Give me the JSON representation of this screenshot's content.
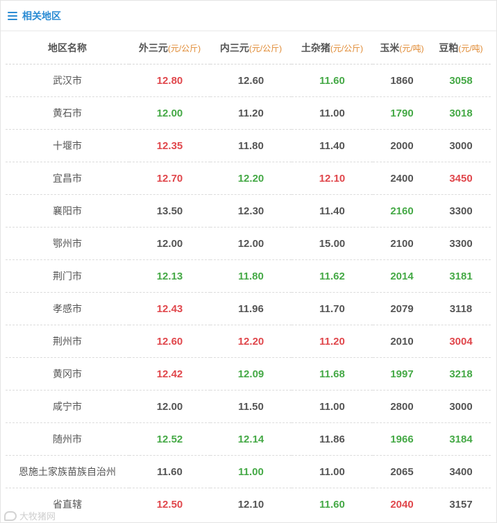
{
  "panel": {
    "title": "相关地区",
    "icon": "menu-icon"
  },
  "table": {
    "columns": [
      {
        "label": "地区名称",
        "unit": ""
      },
      {
        "label": "外三元",
        "unit": "(元/公斤)"
      },
      {
        "label": "内三元",
        "unit": "(元/公斤)"
      },
      {
        "label": "土杂猪",
        "unit": "(元/公斤)"
      },
      {
        "label": "玉米",
        "unit": "(元/吨)"
      },
      {
        "label": "豆粕",
        "unit": "(元/吨)"
      }
    ],
    "colors": {
      "up": "#e0474c",
      "down": "#45a946",
      "flat": "#555555"
    },
    "rows": [
      {
        "name": "武汉市",
        "cells": [
          {
            "v": "12.80",
            "c": "red"
          },
          {
            "v": "12.60",
            "c": ""
          },
          {
            "v": "11.60",
            "c": "green"
          },
          {
            "v": "1860",
            "c": ""
          },
          {
            "v": "3058",
            "c": "green"
          }
        ]
      },
      {
        "name": "黄石市",
        "cells": [
          {
            "v": "12.00",
            "c": "green"
          },
          {
            "v": "11.20",
            "c": ""
          },
          {
            "v": "11.00",
            "c": ""
          },
          {
            "v": "1790",
            "c": "green"
          },
          {
            "v": "3018",
            "c": "green"
          }
        ]
      },
      {
        "name": "十堰市",
        "cells": [
          {
            "v": "12.35",
            "c": "red"
          },
          {
            "v": "11.80",
            "c": ""
          },
          {
            "v": "11.40",
            "c": ""
          },
          {
            "v": "2000",
            "c": ""
          },
          {
            "v": "3000",
            "c": ""
          }
        ]
      },
      {
        "name": "宜昌市",
        "cells": [
          {
            "v": "12.70",
            "c": "red"
          },
          {
            "v": "12.20",
            "c": "green"
          },
          {
            "v": "12.10",
            "c": "red"
          },
          {
            "v": "2400",
            "c": ""
          },
          {
            "v": "3450",
            "c": "red"
          }
        ]
      },
      {
        "name": "襄阳市",
        "cells": [
          {
            "v": "13.50",
            "c": ""
          },
          {
            "v": "12.30",
            "c": ""
          },
          {
            "v": "11.40",
            "c": ""
          },
          {
            "v": "2160",
            "c": "green"
          },
          {
            "v": "3300",
            "c": ""
          }
        ]
      },
      {
        "name": "鄂州市",
        "cells": [
          {
            "v": "12.00",
            "c": ""
          },
          {
            "v": "12.00",
            "c": ""
          },
          {
            "v": "15.00",
            "c": ""
          },
          {
            "v": "2100",
            "c": ""
          },
          {
            "v": "3300",
            "c": ""
          }
        ]
      },
      {
        "name": "荆门市",
        "cells": [
          {
            "v": "12.13",
            "c": "green"
          },
          {
            "v": "11.80",
            "c": "green"
          },
          {
            "v": "11.62",
            "c": "green"
          },
          {
            "v": "2014",
            "c": "green"
          },
          {
            "v": "3181",
            "c": "green"
          }
        ]
      },
      {
        "name": "孝感市",
        "cells": [
          {
            "v": "12.43",
            "c": "red"
          },
          {
            "v": "11.96",
            "c": ""
          },
          {
            "v": "11.70",
            "c": ""
          },
          {
            "v": "2079",
            "c": ""
          },
          {
            "v": "3118",
            "c": ""
          }
        ]
      },
      {
        "name": "荆州市",
        "cells": [
          {
            "v": "12.60",
            "c": "red"
          },
          {
            "v": "12.20",
            "c": "red"
          },
          {
            "v": "11.20",
            "c": "red"
          },
          {
            "v": "2010",
            "c": ""
          },
          {
            "v": "3004",
            "c": "red"
          }
        ]
      },
      {
        "name": "黄冈市",
        "cells": [
          {
            "v": "12.42",
            "c": "red"
          },
          {
            "v": "12.09",
            "c": "green"
          },
          {
            "v": "11.68",
            "c": "green"
          },
          {
            "v": "1997",
            "c": "green"
          },
          {
            "v": "3218",
            "c": "green"
          }
        ]
      },
      {
        "name": "咸宁市",
        "cells": [
          {
            "v": "12.00",
            "c": ""
          },
          {
            "v": "11.50",
            "c": ""
          },
          {
            "v": "11.00",
            "c": ""
          },
          {
            "v": "2800",
            "c": ""
          },
          {
            "v": "3000",
            "c": ""
          }
        ]
      },
      {
        "name": "随州市",
        "cells": [
          {
            "v": "12.52",
            "c": "green"
          },
          {
            "v": "12.14",
            "c": "green"
          },
          {
            "v": "11.86",
            "c": ""
          },
          {
            "v": "1966",
            "c": "green"
          },
          {
            "v": "3184",
            "c": "green"
          }
        ]
      },
      {
        "name": "恩施土家族苗族自治州",
        "cells": [
          {
            "v": "11.60",
            "c": ""
          },
          {
            "v": "11.00",
            "c": "green"
          },
          {
            "v": "11.00",
            "c": ""
          },
          {
            "v": "2065",
            "c": ""
          },
          {
            "v": "3400",
            "c": ""
          }
        ]
      },
      {
        "name": "省直辖",
        "cells": [
          {
            "v": "12.50",
            "c": "red"
          },
          {
            "v": "12.10",
            "c": ""
          },
          {
            "v": "11.60",
            "c": "green"
          },
          {
            "v": "2040",
            "c": "red"
          },
          {
            "v": "3157",
            "c": ""
          }
        ]
      }
    ]
  },
  "watermark": {
    "text": "大牧猪网",
    "icon": "logo-icon"
  }
}
